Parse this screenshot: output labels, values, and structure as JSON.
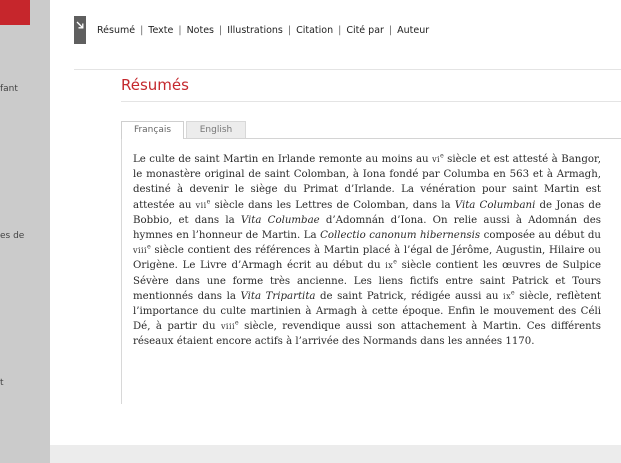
{
  "sidebar": {
    "fragments": [
      "fant",
      "es de",
      "t"
    ]
  },
  "nav": {
    "items": [
      "Résumé",
      "Texte",
      "Notes",
      "Illustrations",
      "Citation",
      "Cité par",
      "Auteur"
    ],
    "separator": "|"
  },
  "section": {
    "title": "Résumés"
  },
  "tabs": {
    "items": [
      "Français",
      "English"
    ],
    "active": "Français"
  },
  "abstract": {
    "text": [
      {
        "t": "Le culte de saint Martin en Irlande remonte au moins au "
      },
      {
        "t": "vi",
        "s": "sc"
      },
      {
        "t": "e",
        "s": "sup"
      },
      {
        "t": " siècle et est attesté à Bangor, le monastère original de saint Colomban, à Iona fondé par Columba en 563 et à Armagh, destiné à devenir le siège du Primat d’Irlande. La vénération pour saint Martin est attestée au "
      },
      {
        "t": "vii",
        "s": "sc"
      },
      {
        "t": "e",
        "s": "sup"
      },
      {
        "t": " siècle dans les Lettres de Colomban, dans la "
      },
      {
        "t": "Vita Columbani",
        "s": "i"
      },
      {
        "t": " de Jonas de Bobbio, et dans la "
      },
      {
        "t": "Vita Columbae",
        "s": "i"
      },
      {
        "t": " d’Adomnán d’Iona. On relie aussi à Adomnán des hymnes en l’honneur de Martin. La "
      },
      {
        "t": "Collectio canonum hibernensis",
        "s": "i"
      },
      {
        "t": " composée au début du "
      },
      {
        "t": "viii",
        "s": "sc"
      },
      {
        "t": "e",
        "s": "sup"
      },
      {
        "t": " siècle contient des références à Martin placé à l’égal de Jérôme, Augustin, Hilaire ou Origène. Le Livre d’Armagh écrit au début du "
      },
      {
        "t": "ix",
        "s": "sc"
      },
      {
        "t": "e",
        "s": "sup"
      },
      {
        "t": " siècle contient les œuvres de Sulpice Sévère dans une forme très ancienne. Les liens fictifs entre saint Patrick et Tours mentionnés dans la "
      },
      {
        "t": "Vita Tripartita",
        "s": "i"
      },
      {
        "t": " de saint Patrick, rédigée aussi au "
      },
      {
        "t": "ix",
        "s": "sc"
      },
      {
        "t": "e",
        "s": "sup"
      },
      {
        "t": " siècle, reflètent l’importance du culte martinien à Armagh à cette époque. Enfin le mouvement des Céli Dé, à partir du "
      },
      {
        "t": "viii",
        "s": "sc"
      },
      {
        "t": "e",
        "s": "sup"
      },
      {
        "t": " siècle, revendique aussi son attachement à Martin. Ces différents réseaux étaient encore actifs à l’arrivée des Normands dans les années 1170."
      }
    ]
  },
  "colors": {
    "accent": "#c4282d",
    "sidebar": "#cbcbcb",
    "toggle": "#5f5f5f"
  },
  "icons": {
    "toggle": "arrow-down-right-icon"
  }
}
